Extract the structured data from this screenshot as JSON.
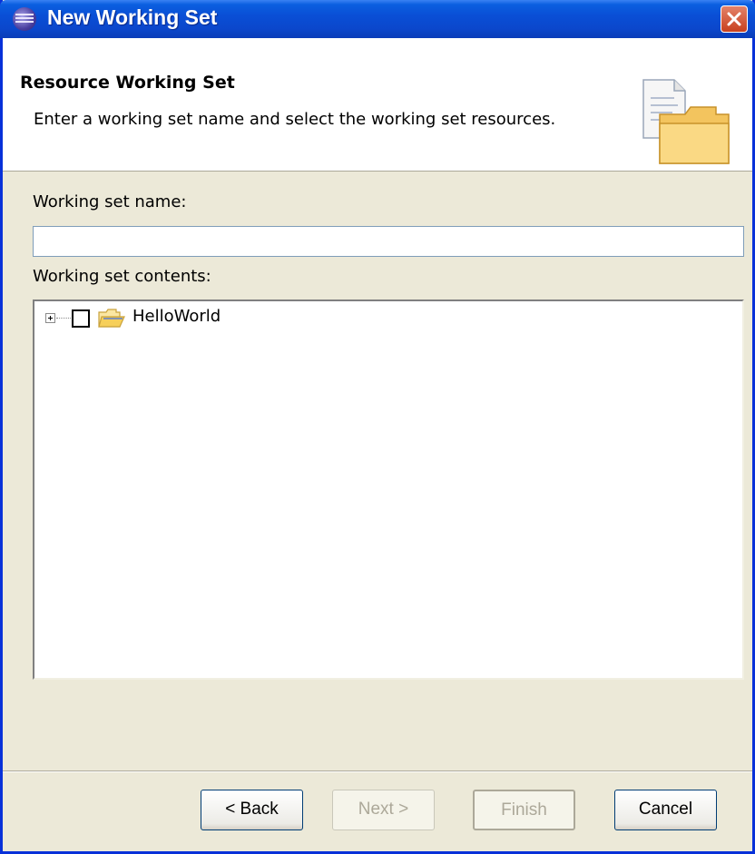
{
  "window": {
    "title": "New Working Set"
  },
  "banner": {
    "title": "Resource Working Set",
    "description": "Enter a working set name and select the working set resources."
  },
  "form": {
    "name_label": "Working set name:",
    "name_value": "",
    "contents_label": "Working set contents:"
  },
  "tree": {
    "items": [
      {
        "label": "HelloWorld",
        "checked": false,
        "expanded": false,
        "icon": "folder-icon"
      }
    ]
  },
  "buttons": {
    "back": "< Back",
    "next": "Next >",
    "finish": "Finish",
    "cancel": "Cancel"
  }
}
